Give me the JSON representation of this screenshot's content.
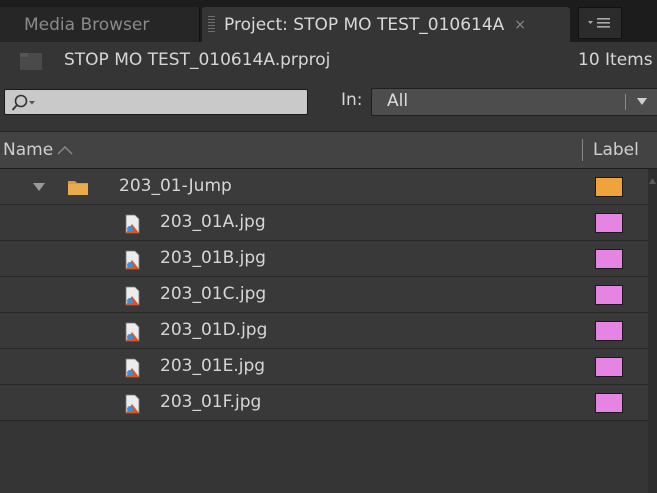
{
  "tabs": {
    "media_browser": "Media Browser",
    "project": "Project: STOP MO TEST_010614A",
    "close_glyph": "×",
    "menu_icon": "panel-menu-icon"
  },
  "project": {
    "name": "STOP MO TEST_010614A.prproj",
    "item_count": "10 Items",
    "icon": "project-icon"
  },
  "search": {
    "value": "",
    "icon": "search-icon",
    "in_label": "In:",
    "in_value": "All"
  },
  "columns": {
    "name": "Name",
    "label": "Label"
  },
  "colors": {
    "folder_label": "#f0a33a",
    "file_label": "#e584e3",
    "folder_icon": "#d89a3c"
  },
  "rows": [
    {
      "type": "folder",
      "name": "203_01-Jump",
      "label_color": "#f0a33a",
      "expanded": true
    },
    {
      "type": "file",
      "name": "203_01A.jpg",
      "label_color": "#e584e3"
    },
    {
      "type": "file",
      "name": "203_01B.jpg",
      "label_color": "#e584e3"
    },
    {
      "type": "file",
      "name": "203_01C.jpg",
      "label_color": "#e584e3"
    },
    {
      "type": "file",
      "name": "203_01D.jpg",
      "label_color": "#e584e3"
    },
    {
      "type": "file",
      "name": "203_01E.jpg",
      "label_color": "#e584e3"
    },
    {
      "type": "file",
      "name": "203_01F.jpg",
      "label_color": "#e584e3"
    }
  ]
}
